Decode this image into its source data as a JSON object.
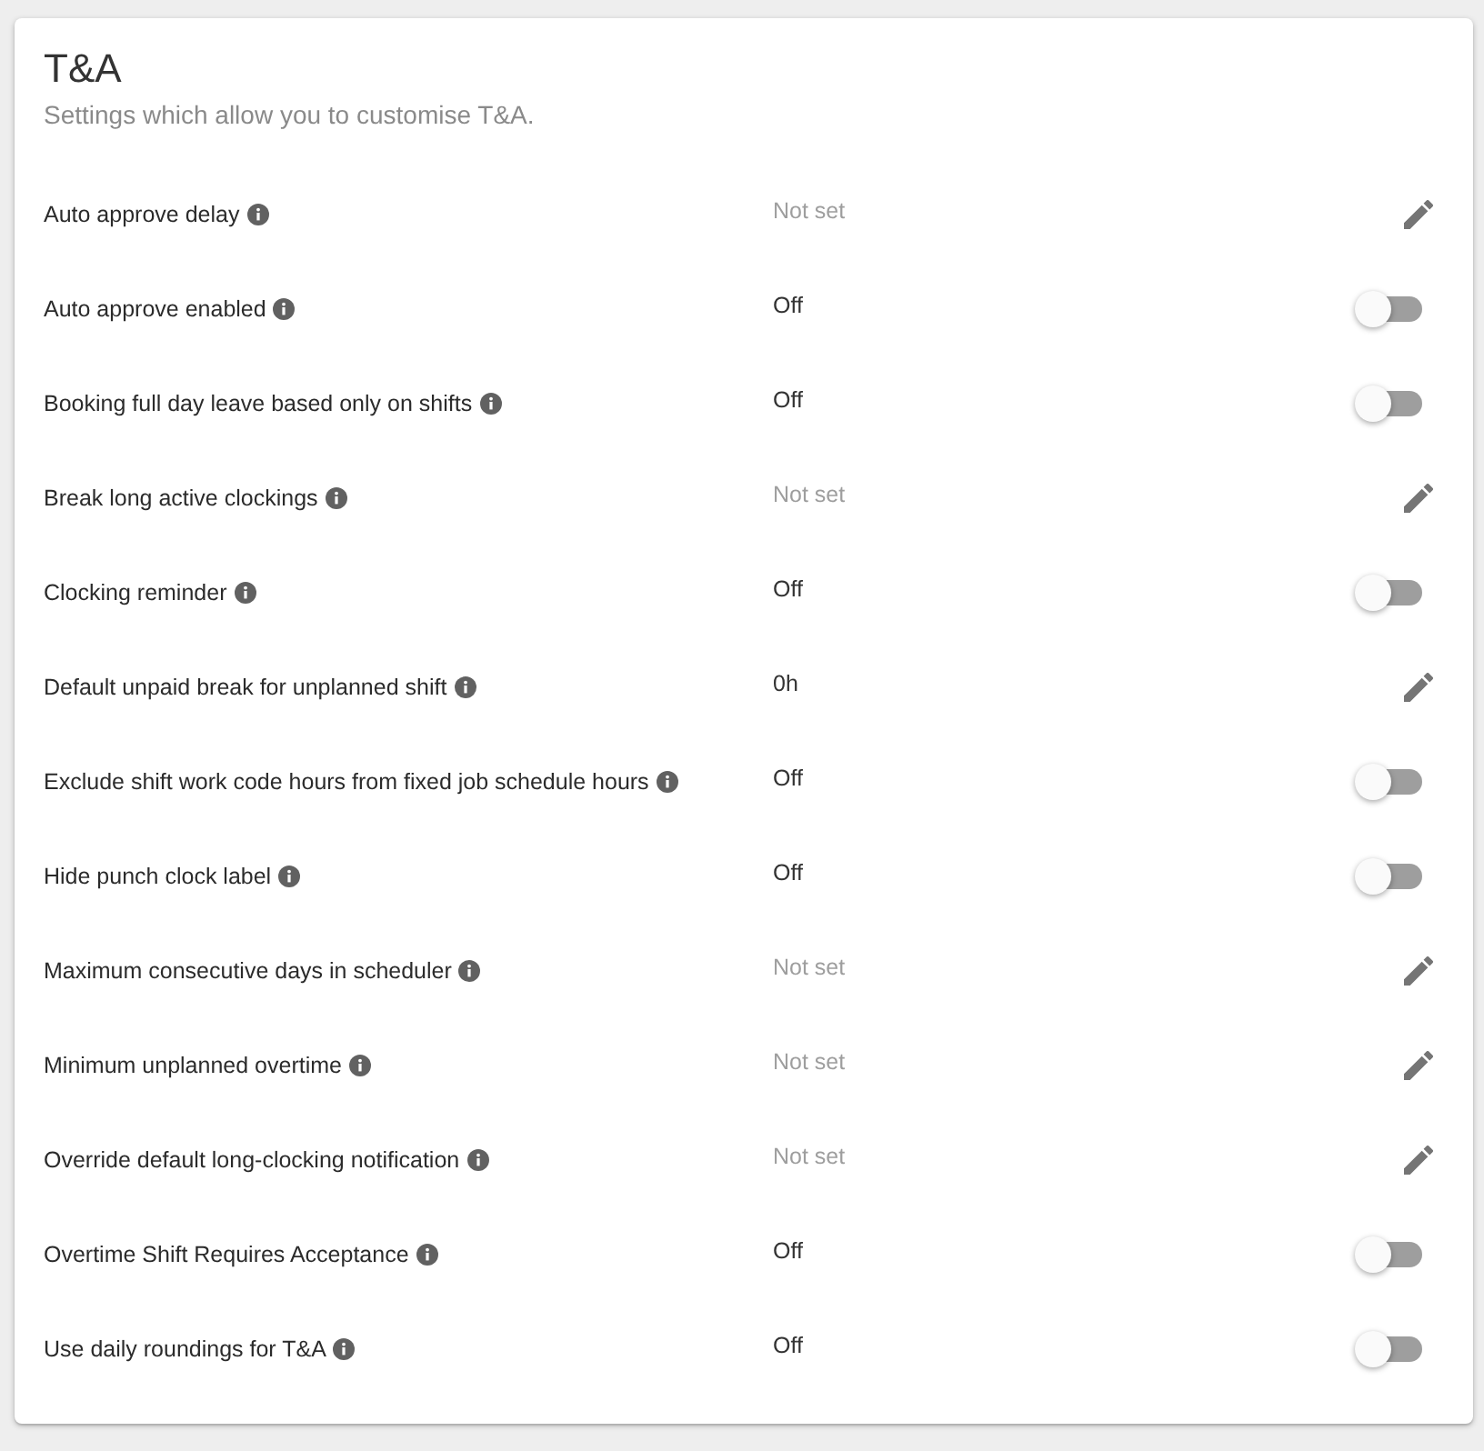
{
  "card": {
    "title": "T&A",
    "subtitle": "Settings which allow you to customise T&A."
  },
  "settings": [
    {
      "label": "Auto approve delay",
      "value": "Not set",
      "empty": true,
      "kind": "edit"
    },
    {
      "label": "Auto approve enabled",
      "value": "Off",
      "empty": false,
      "kind": "toggle",
      "on": false
    },
    {
      "label": "Booking full day leave based only on shifts",
      "value": "Off",
      "empty": false,
      "kind": "toggle",
      "on": false
    },
    {
      "label": "Break long active clockings",
      "value": "Not set",
      "empty": true,
      "kind": "edit"
    },
    {
      "label": "Clocking reminder",
      "value": "Off",
      "empty": false,
      "kind": "toggle",
      "on": false
    },
    {
      "label": "Default unpaid break for unplanned shift",
      "value": "0h",
      "empty": false,
      "kind": "edit"
    },
    {
      "label": "Exclude shift work code hours from fixed job schedule hours",
      "value": "Off",
      "empty": false,
      "kind": "toggle",
      "on": false
    },
    {
      "label": "Hide punch clock label",
      "value": "Off",
      "empty": false,
      "kind": "toggle",
      "on": false
    },
    {
      "label": "Maximum consecutive days in scheduler",
      "value": "Not set",
      "empty": true,
      "kind": "edit"
    },
    {
      "label": "Minimum unplanned overtime",
      "value": "Not set",
      "empty": true,
      "kind": "edit"
    },
    {
      "label": "Override default long-clocking notification",
      "value": "Not set",
      "empty": true,
      "kind": "edit"
    },
    {
      "label": "Overtime Shift Requires Acceptance",
      "value": "Off",
      "empty": false,
      "kind": "toggle",
      "on": false
    },
    {
      "label": "Use daily roundings for T&A",
      "value": "Off",
      "empty": false,
      "kind": "toggle",
      "on": false
    }
  ]
}
